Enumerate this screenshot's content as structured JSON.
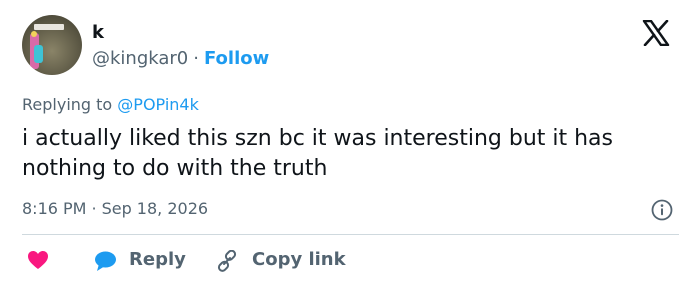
{
  "author": {
    "display_name": "k",
    "handle": "@kingkar0",
    "separator": "·",
    "follow_label": "Follow"
  },
  "replying": {
    "prefix": "Replying to",
    "mention": "@POPin4k"
  },
  "tweet": {
    "text": "i actually liked this szn bc it was interesting but it has nothing to do with the truth"
  },
  "meta": {
    "time": "8:16 PM",
    "separator": "·",
    "date": "Sep 18, 2026"
  },
  "actions": {
    "reply_label": "Reply",
    "copy_label": "Copy link"
  },
  "icons": {
    "brand": "x-logo-icon",
    "info": "info-icon",
    "like": "heart-icon",
    "reply": "chat-bubble-icon",
    "copy": "link-icon"
  },
  "colors": {
    "accent": "#1d9bf0",
    "muted": "#536471",
    "text": "#0f1419",
    "like": "#f91880",
    "divider": "#cfd9de"
  }
}
